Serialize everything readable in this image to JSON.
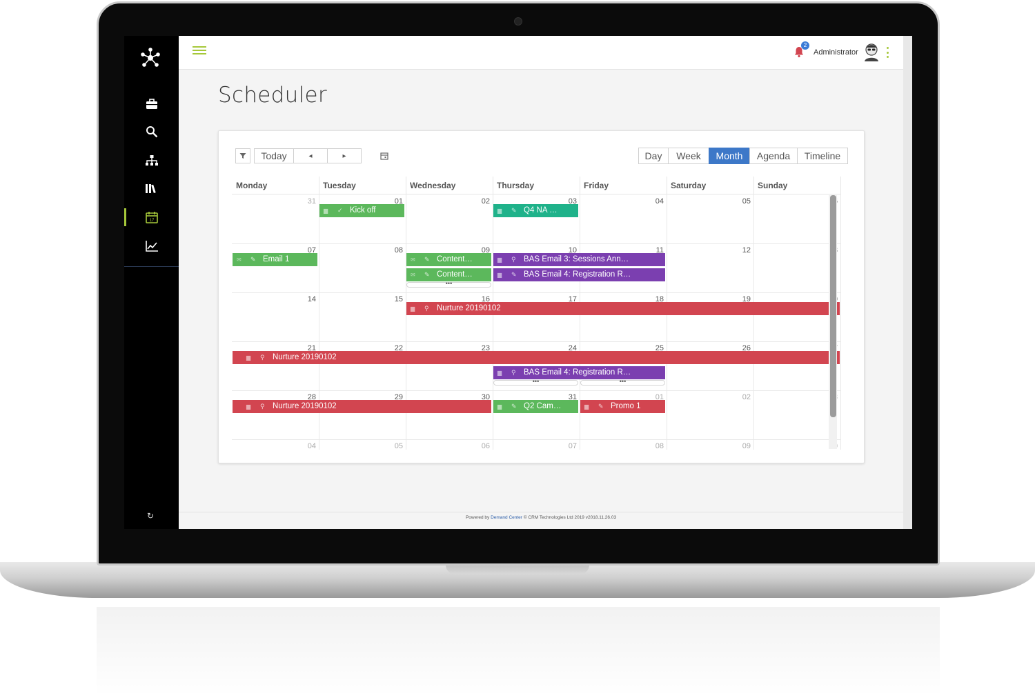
{
  "app": {
    "page_title": "Scheduler",
    "user_name": "Administrator",
    "notification_count": "2"
  },
  "sidebar": {
    "items": [
      {
        "icon": "briefcase-icon"
      },
      {
        "icon": "search-icon"
      },
      {
        "icon": "hierarchy-icon"
      },
      {
        "icon": "library-icon"
      },
      {
        "icon": "calendar-icon",
        "day": "17",
        "active": true
      },
      {
        "icon": "chart-icon"
      }
    ]
  },
  "toolbar": {
    "today_label": "Today",
    "prev_label": "◂",
    "next_label": "▸",
    "views": [
      "Day",
      "Week",
      "Month",
      "Agenda",
      "Timeline"
    ],
    "active_view": "Month"
  },
  "calendar": {
    "weekdays": [
      "Monday",
      "Tuesday",
      "Wednesday",
      "Thursday",
      "Friday",
      "Saturday",
      "Sunday"
    ],
    "weeks": [
      [
        "31",
        "01",
        "02",
        "03",
        "04",
        "05",
        "06"
      ],
      [
        "07",
        "08",
        "09",
        "10",
        "11",
        "12",
        "13"
      ],
      [
        "14",
        "15",
        "16",
        "17",
        "18",
        "19",
        "20"
      ],
      [
        "21",
        "22",
        "23",
        "24",
        "25",
        "26",
        "27"
      ],
      [
        "28",
        "29",
        "30",
        "31",
        "01",
        "02",
        "03"
      ],
      [
        "04",
        "05",
        "06",
        "07",
        "08",
        "09",
        "10"
      ]
    ],
    "events": [
      {
        "title": "Kick off",
        "color": "#5cb85c"
      },
      {
        "title": "Q4 NA …",
        "color": "#1fb28a"
      },
      {
        "title": "Email 1",
        "color": "#5cb85c"
      },
      {
        "title": "Content…",
        "color": "#5cb85c"
      },
      {
        "title": "Content…",
        "color": "#5cb85c"
      },
      {
        "title": "BAS Email 3: Sessions Ann…",
        "color": "#7b3fb0"
      },
      {
        "title": "BAS Email 4: Registration R…",
        "color": "#7b3fb0"
      },
      {
        "title": "Nurture 20190102",
        "color": "#d24550"
      },
      {
        "title": "Nurture 20190102",
        "color": "#d24550"
      },
      {
        "title": "BAS Email 4: Registration R…",
        "color": "#7b3fb0"
      },
      {
        "title": "Nurture 20190102",
        "color": "#d24550"
      },
      {
        "title": "Q2 Cam…",
        "color": "#5cb85c"
      },
      {
        "title": "Promo 1",
        "color": "#d24550"
      }
    ],
    "more_label": "•••"
  },
  "footer": {
    "powered_by": "Powered by",
    "brand_link": "Demand Center",
    "copyright": "© CRM Technologies Ltd 2019 v2018.11.26.03"
  }
}
